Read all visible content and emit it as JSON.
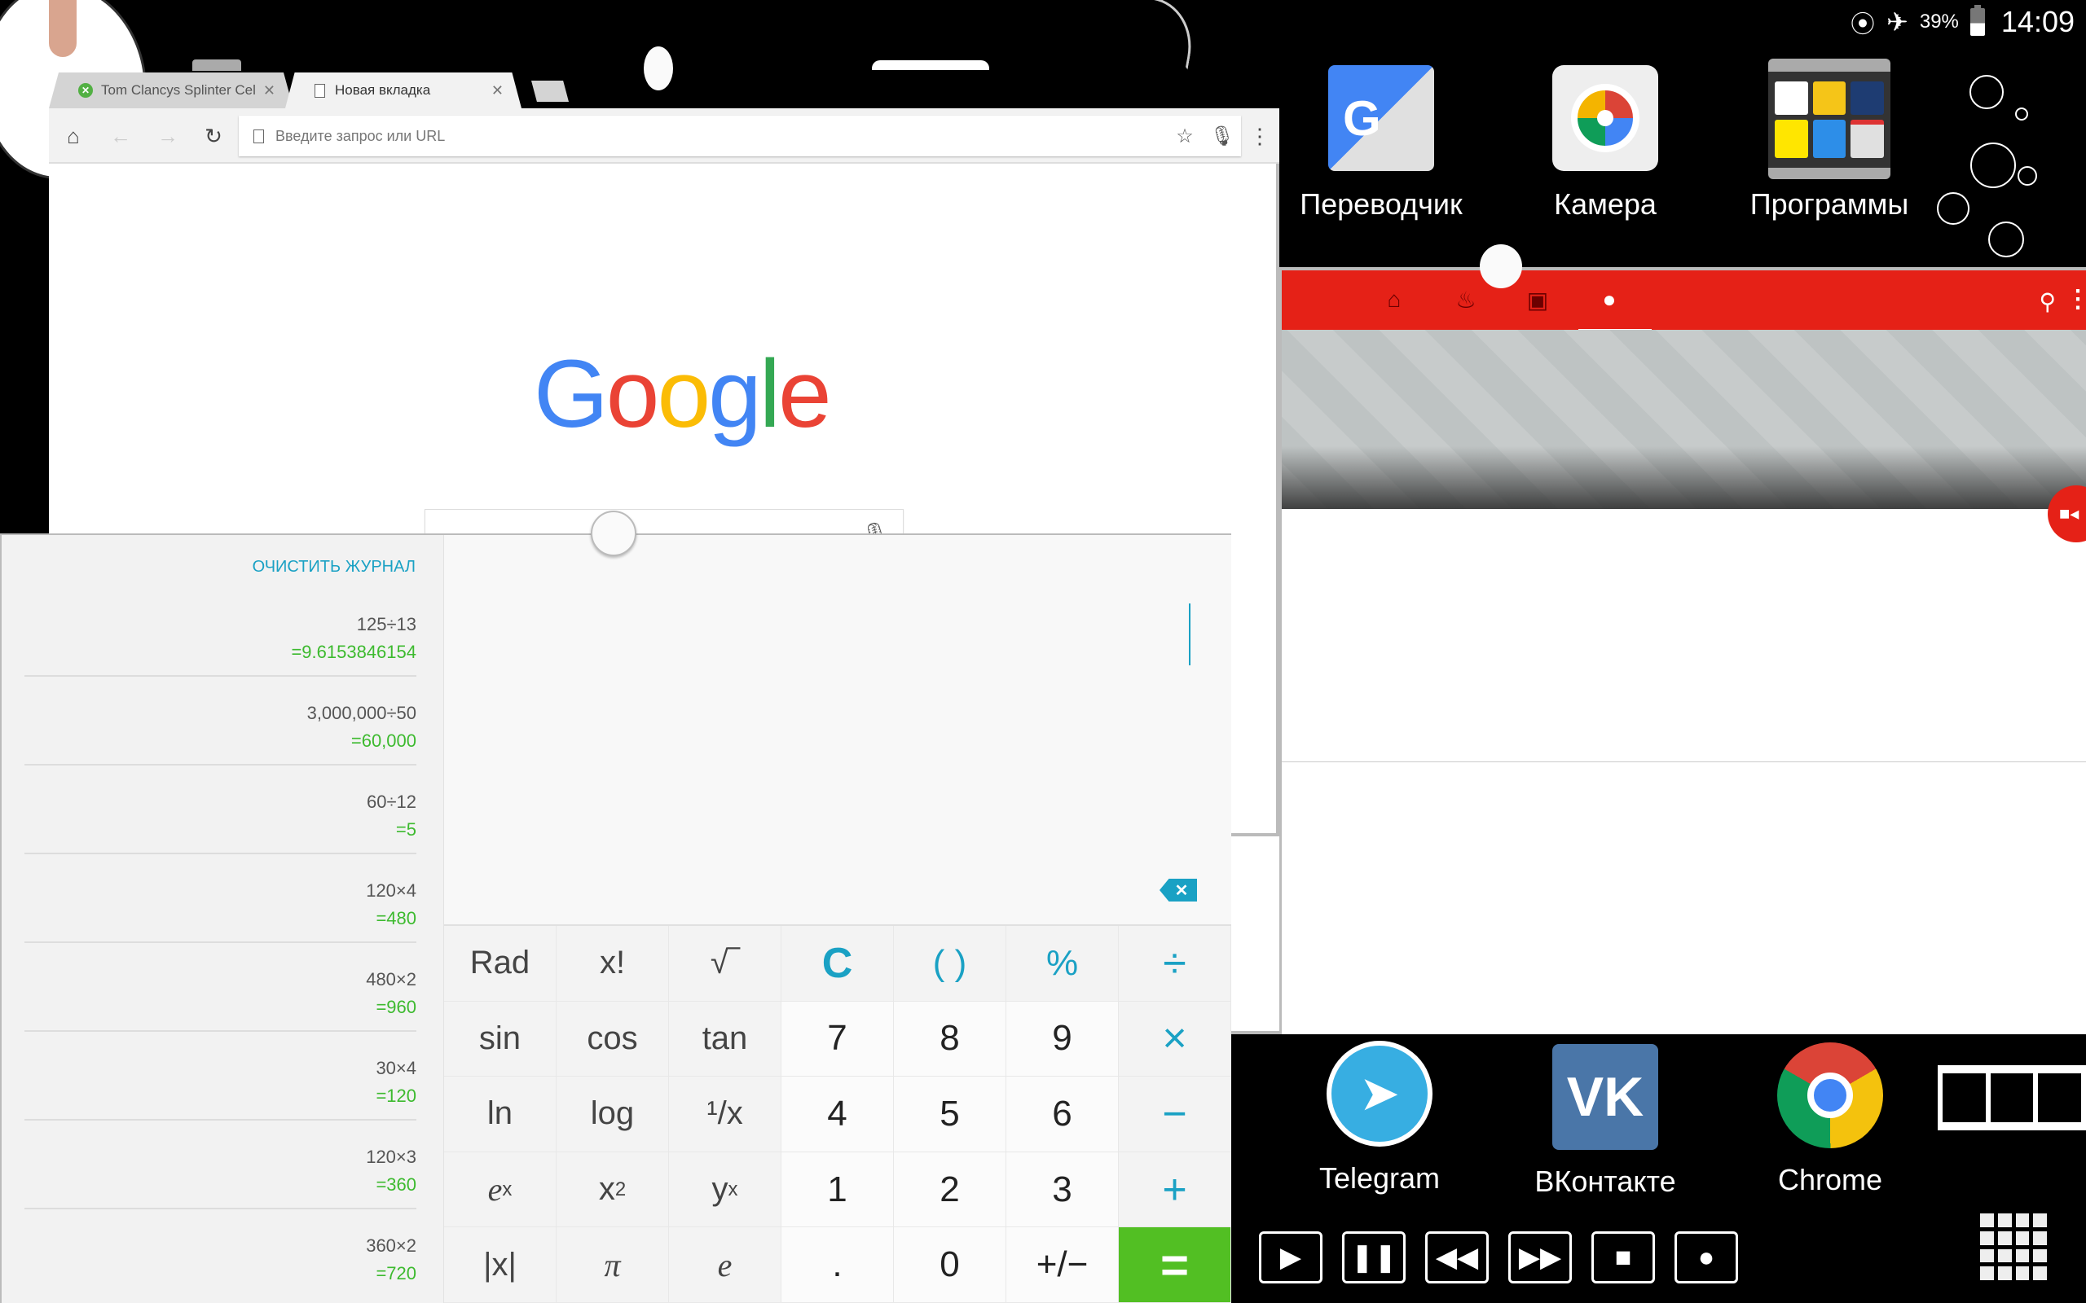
{
  "status_bar": {
    "battery_percent": "39%",
    "battery_level": 0.39,
    "time": "14:09",
    "icons": [
      "wifi-icon",
      "airplane-mode-icon",
      "battery-icon"
    ]
  },
  "browser": {
    "tabs": [
      {
        "title": "Tom Clancys Splinter Cell: Bl",
        "icon": "xbox-icon",
        "active": false
      },
      {
        "title": "Новая вкладка",
        "icon": "page-icon",
        "active": true
      }
    ],
    "omnibox_placeholder": "Введите запрос или URL",
    "omnibox_value": "",
    "google_logo": [
      "G",
      "o",
      "o",
      "g",
      "l",
      "e"
    ],
    "search_value": ""
  },
  "home_apps_top": [
    {
      "label": "Переводчик",
      "icon": "google-translate-icon"
    },
    {
      "label": "Камера",
      "icon": "camera-icon"
    },
    {
      "label": "Программы",
      "icon": "folder-icon"
    }
  ],
  "dock_apps": [
    {
      "label": "Telegram",
      "icon": "telegram-icon"
    },
    {
      "label": "ВКонтакте",
      "icon": "vk-icon"
    },
    {
      "label": "Chrome",
      "icon": "chrome-icon"
    }
  ],
  "youtube": {
    "tabs": [
      "home-icon",
      "trending-icon",
      "subscriptions-icon",
      "account-icon"
    ],
    "active_tab": "account-icon",
    "accent": "#e52117"
  },
  "media_controls": [
    "play",
    "pause",
    "rewind",
    "fast-forward",
    "stop",
    "record"
  ],
  "calculator": {
    "clear_history_label": "ОЧИСТИТЬ ЖУРНАЛ",
    "display_value": "",
    "history": [
      {
        "expr": "125÷13",
        "result": "=9.6153846154"
      },
      {
        "expr": "3,000,000÷50",
        "result": "=60,000"
      },
      {
        "expr": "60÷12",
        "result": "=5"
      },
      {
        "expr": "120×4",
        "result": "=480"
      },
      {
        "expr": "480×2",
        "result": "=960"
      },
      {
        "expr": "30×4",
        "result": "=120"
      },
      {
        "expr": "120×3",
        "result": "=360"
      },
      {
        "expr": "360×2",
        "result": "=720"
      }
    ],
    "keys": {
      "rad": "Rad",
      "fact": "x!",
      "sqrt": "√‾",
      "clear": "C",
      "paren": "( )",
      "percent": "%",
      "divide": "÷",
      "sin": "sin",
      "cos": "cos",
      "tan": "tan",
      "seven": "7",
      "eight": "8",
      "nine": "9",
      "multiply": "×",
      "ln": "ln",
      "log": "log",
      "recip": "¹/x",
      "four": "4",
      "five": "5",
      "six": "6",
      "minus": "−",
      "exp_base": "e",
      "exp_sup": "x",
      "sq_base": "x",
      "sq_sup": "2",
      "pow_base": "y",
      "pow_sup": "x",
      "one": "1",
      "two": "2",
      "three": "3",
      "plus": "+",
      "abs": "|x|",
      "pi": "π",
      "e": "e",
      "dot": ".",
      "zero": "0",
      "sign": "+/−",
      "equals": "="
    },
    "colors": {
      "accent": "#1aa1c4",
      "result": "#3dba2f",
      "equals_bg": "#52bf23"
    }
  }
}
